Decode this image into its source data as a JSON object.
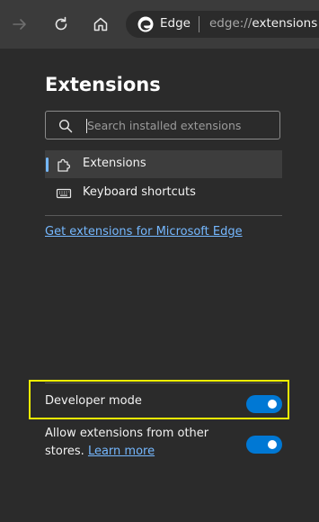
{
  "browser": {
    "app_name": "Edge",
    "url_scheme": "edge://",
    "url_host": "extensions"
  },
  "extensions_page": {
    "title": "Extensions",
    "search": {
      "placeholder": "Search installed extensions",
      "value": ""
    },
    "nav": [
      {
        "label": "Extensions",
        "icon": "puzzle-icon",
        "active": true
      },
      {
        "label": "Keyboard shortcuts",
        "icon": "keyboard-icon",
        "active": false
      }
    ],
    "get_link": "Get extensions for Microsoft Edge",
    "developer_mode": {
      "label": "Developer mode",
      "on": true
    },
    "allow_other_stores": {
      "label": "Allow extensions from other stores.",
      "link": "Learn more",
      "on": true
    }
  },
  "colors": {
    "accent": "#0078d4",
    "link": "#75b8ff",
    "highlight_box": "#f2f200",
    "background": "#2b2b2b"
  }
}
